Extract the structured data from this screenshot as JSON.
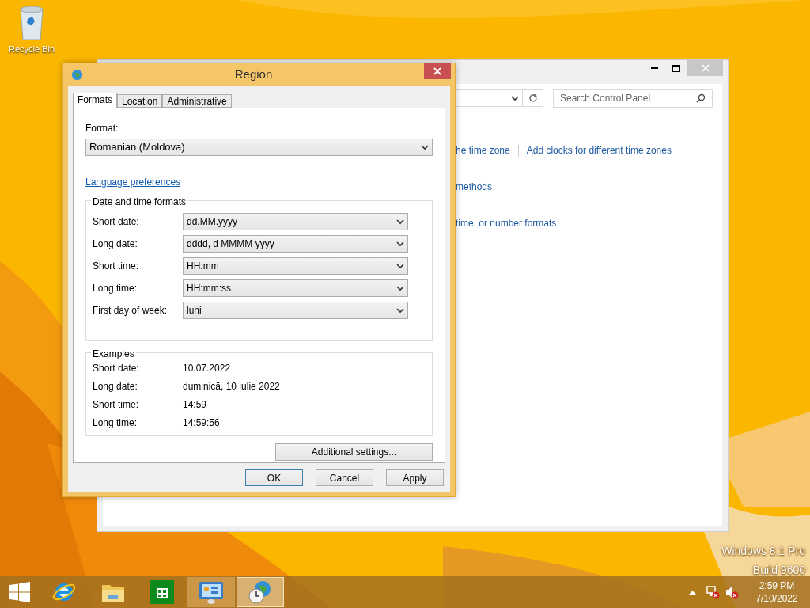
{
  "desktop": {
    "icons": [
      {
        "label": "Recycle Bin"
      }
    ],
    "edition_lines": [
      "Windows 8.1 Pro",
      "Build 9600"
    ]
  },
  "control_panel": {
    "search": {
      "placeholder": "Search Control Panel"
    },
    "link_rows": [
      [
        "he time zone",
        "Add clocks for different time zones"
      ],
      [
        "methods"
      ],
      [
        "time, or number formats"
      ]
    ]
  },
  "dialog": {
    "title": "Region",
    "tabs": [
      {
        "label": "Formats",
        "selected": true
      },
      {
        "label": "Location",
        "selected": false
      },
      {
        "label": "Administrative",
        "selected": false
      }
    ],
    "format": {
      "label": "Format:",
      "value": "Romanian (Moldova)"
    },
    "language_link": "Language preferences",
    "formats_group": {
      "title": "Date and time formats",
      "fields": [
        {
          "label": "Short date:",
          "value": "dd.MM.yyyy"
        },
        {
          "label": "Long date:",
          "value": "dddd, d MMMM yyyy"
        },
        {
          "label": "Short time:",
          "value": "HH:mm"
        },
        {
          "label": "Long time:",
          "value": "HH:mm:ss"
        },
        {
          "label": "First day of week:",
          "value": "luni"
        }
      ]
    },
    "examples_group": {
      "title": "Examples",
      "rows": [
        {
          "label": "Short date:",
          "value": "10.07.2022"
        },
        {
          "label": "Long date:",
          "value": "duminică, 10 iulie 2022"
        },
        {
          "label": "Short time:",
          "value": "14:59"
        },
        {
          "label": "Long time:",
          "value": "14:59:56"
        }
      ]
    },
    "additional_button": "Additional settings...",
    "buttons": [
      {
        "label": "OK",
        "default": true
      },
      {
        "label": "Cancel",
        "default": false
      },
      {
        "label": "Apply",
        "default": false
      }
    ]
  },
  "taskbar": {
    "apps": [
      {
        "kind": "browser",
        "active": false
      },
      {
        "kind": "explorer",
        "active": false
      },
      {
        "kind": "store",
        "active": false
      },
      {
        "kind": "control",
        "active": true
      },
      {
        "kind": "region",
        "active": true
      }
    ],
    "time": "2:59 PM",
    "date": "7/10/2022"
  }
}
